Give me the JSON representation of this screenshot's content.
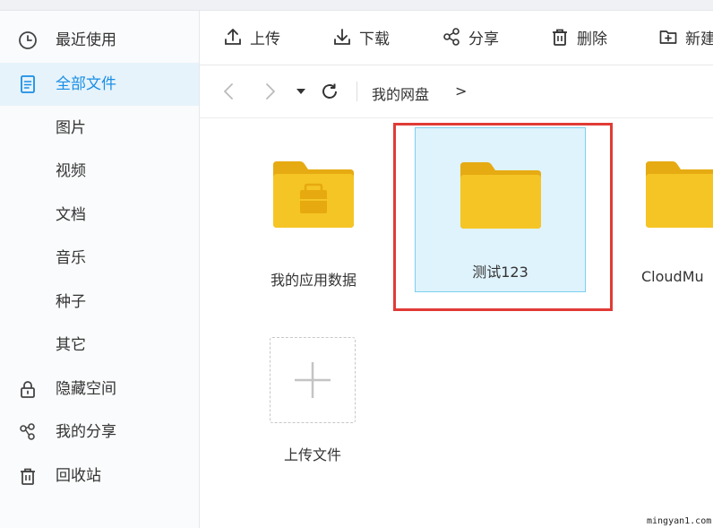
{
  "sidebar": {
    "items": [
      {
        "label": "最近使用",
        "icon": "clock-icon",
        "active": false
      },
      {
        "label": "全部文件",
        "icon": "document-icon",
        "active": true
      },
      {
        "label": "图片"
      },
      {
        "label": "视频"
      },
      {
        "label": "文档"
      },
      {
        "label": "音乐"
      },
      {
        "label": "种子"
      },
      {
        "label": "其它"
      },
      {
        "label": "隐藏空间",
        "icon": "lock-icon"
      },
      {
        "label": "我的分享",
        "icon": "share-icon"
      },
      {
        "label": "回收站",
        "icon": "trash-icon"
      }
    ]
  },
  "toolbar": {
    "upload_label": "上传",
    "download_label": "下载",
    "share_label": "分享",
    "delete_label": "删除",
    "new_label": "新建"
  },
  "nav": {
    "breadcrumb": "我的网盘",
    "breadcrumb_separator": ">"
  },
  "files": [
    {
      "name": "我的应用数据",
      "type": "folder",
      "variant": "app-data"
    },
    {
      "name": "测试123",
      "type": "folder",
      "selected": true
    },
    {
      "name": "CloudMu",
      "type": "folder"
    }
  ],
  "upload_tile": {
    "label": "上传文件"
  },
  "watermark": "mingyan1.com",
  "colors": {
    "accent": "#1a8ee5",
    "active_bg": "#e6f3fb",
    "folder": "#f5c525",
    "folder_tab": "#e6ab12",
    "selected_bg": "#dff3fc",
    "highlight_red": "#e03b36"
  }
}
